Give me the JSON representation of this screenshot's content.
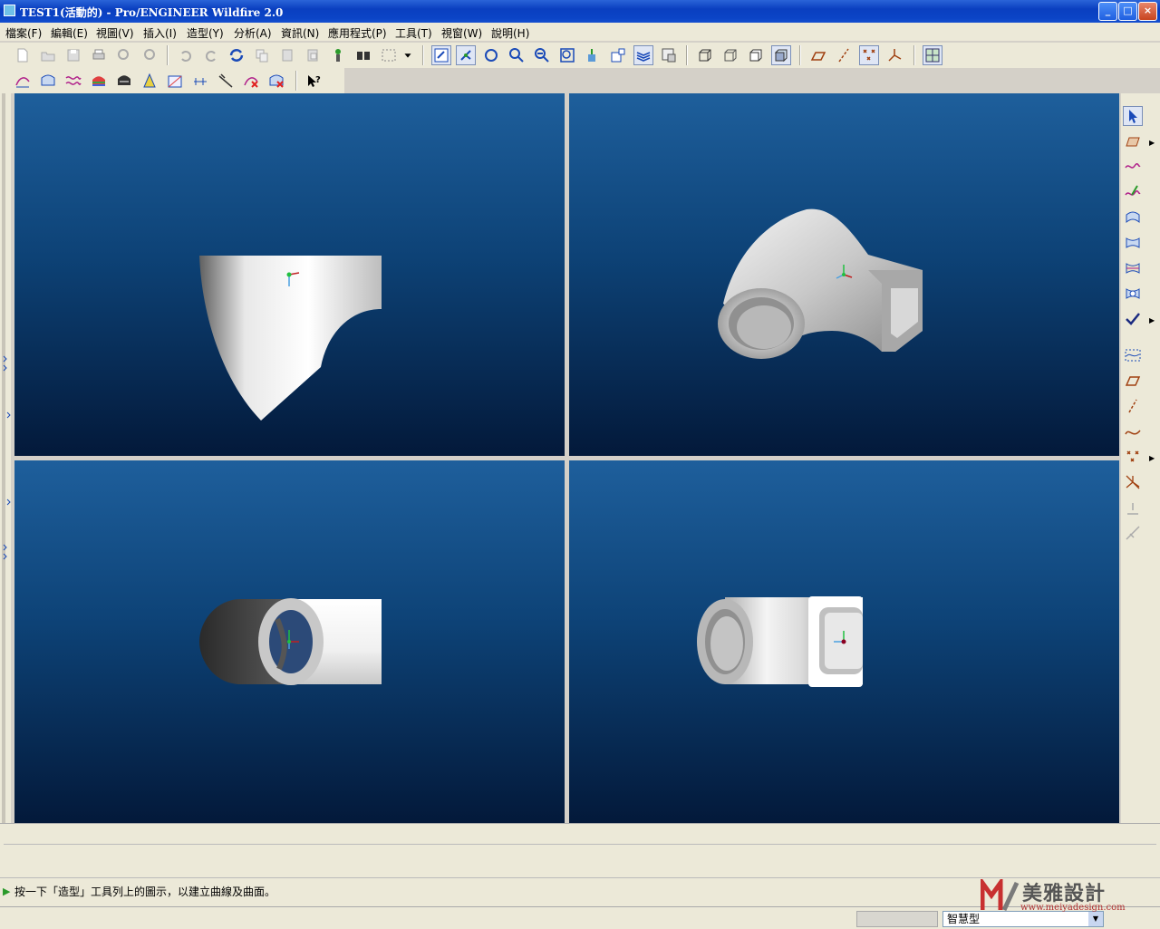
{
  "window": {
    "title": "TEST1(活動的) - Pro/ENGINEER Wildfire 2.0",
    "buttons": {
      "minimize": "_",
      "maximize": "□",
      "close": "×"
    }
  },
  "menu": {
    "items": [
      "檔案(F)",
      "編輯(E)",
      "視圖(V)",
      "插入(I)",
      "造型(Y)",
      "分析(A)",
      "資訊(N)",
      "應用程式(P)",
      "工具(T)",
      "視窗(W)",
      "說明(H)"
    ]
  },
  "toolbar_top": {
    "icons": [
      "new-icon",
      "open-icon",
      "save-icon",
      "print-icon",
      "save-copy-icon",
      "erase-icon",
      "undo-icon",
      "redo-icon",
      "regenerate-icon",
      "copy-icon",
      "paste-icon",
      "paste-special-icon",
      "model-tree-icon",
      "find-icon",
      "select-box-icon",
      "select-dropdown-icon",
      "repaint-icon",
      "spin-center-icon",
      "orient-icon",
      "zoom-in-icon",
      "zoom-out-icon",
      "refit-icon",
      "saved-views-icon",
      "view-manager-icon",
      "layers-icon",
      "model-display-icon",
      "wireframe-icon",
      "hidden-line-icon",
      "no-hidden-icon",
      "shading-icon",
      "datum-planes-icon",
      "datum-axes-icon",
      "datum-points-icon",
      "coordinate-systems-icon",
      "multi-view-icon"
    ]
  },
  "toolbar_bottom": {
    "icons": [
      "curve-analysis-icon",
      "surface-analysis-icon",
      "curvature-icon",
      "reflection-icon",
      "shade-analysis-icon",
      "draft-icon",
      "slope-icon",
      "dihedral-icon",
      "connectivity-icon",
      "delete-curve-analysis-icon",
      "delete-surface-analysis-icon",
      "context-help-icon"
    ]
  },
  "right_toolbar": {
    "icons": [
      "select-arrow-icon",
      "active-plane-icon",
      "curve-icon",
      "sketch-curve-icon",
      "boundary-surface-icon",
      "loft-surface-icon",
      "curve-from-surface-icon",
      "surface-trim-icon",
      "done-check-icon",
      "curve-tool-icon",
      "plane-tool-icon",
      "axis-tool-icon",
      "sketched-datum-icon",
      "point-tool-icon",
      "csys-tool-icon",
      "analysis-tool-icon",
      "trim-tool-icon"
    ]
  },
  "viewports": [
    {
      "name": "front-view"
    },
    {
      "name": "isometric-view"
    },
    {
      "name": "top-view"
    },
    {
      "name": "right-view"
    }
  ],
  "message": {
    "text": "按一下「造型」工具列上的圖示，以建立曲線及曲面。"
  },
  "status": {
    "filter_value": "智慧型"
  },
  "watermark": {
    "brand": "美雅設計",
    "url": "www.meiyadesign.com"
  },
  "colors": {
    "title_blue": "#0a3fc0",
    "viewport_top": "#1e5f9c",
    "viewport_bottom": "#03193a",
    "axis_x": "#c02020",
    "axis_y": "#20c040",
    "axis_z": "#4aa0e0"
  }
}
